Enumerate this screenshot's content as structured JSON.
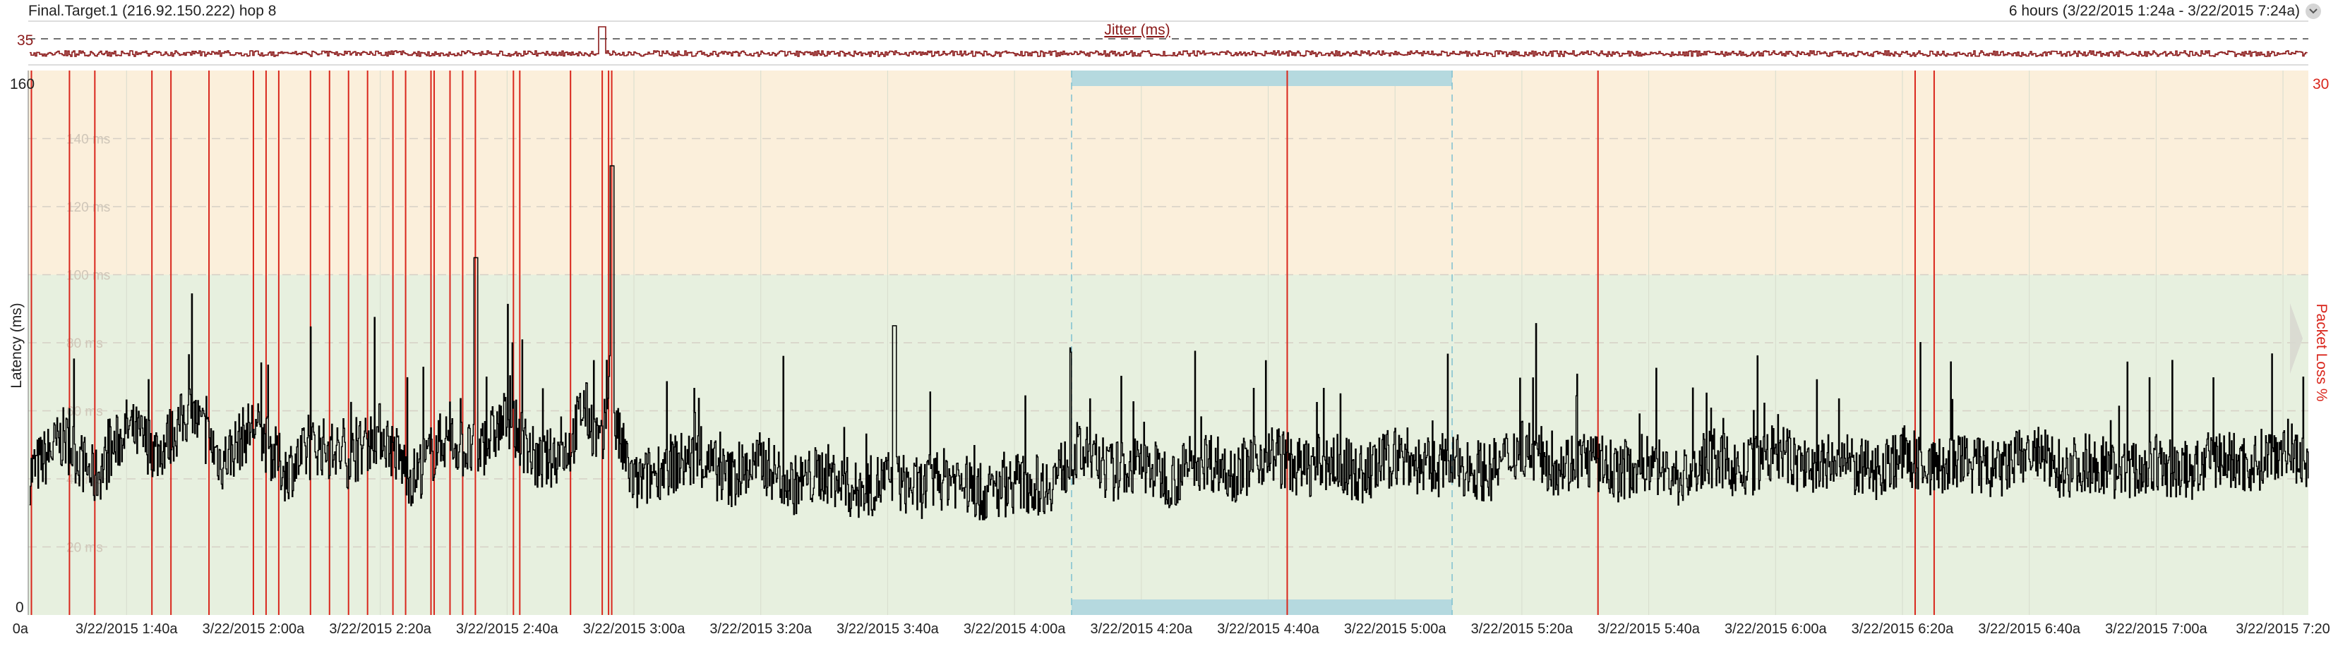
{
  "header": {
    "target": "Final.Target.1 (216.92.150.222) hop 8",
    "time_range": "6 hours (3/22/2015 1:24a - 3/22/2015 7:24a)"
  },
  "jitter": {
    "title": "Jitter (ms)",
    "scale_label": "35",
    "color": "#8b1a1a"
  },
  "chart_data": {
    "type": "line",
    "ylabel": "Latency (ms)",
    "y2label": "Packet Loss %",
    "ylim": [
      0,
      160
    ],
    "y2lim": [
      0,
      30
    ],
    "y_tick_labels": {
      "bottom": "0",
      "top": "160"
    },
    "y2_tick_label": "30",
    "zone_labels": [
      "140 ms",
      "120 ms",
      "100 ms",
      "80 ms",
      "60 ms",
      "40 ms",
      "20 ms"
    ],
    "zones": [
      {
        "from": 100,
        "to": 160,
        "color": "#fbefdb"
      },
      {
        "from": 0,
        "to": 100,
        "color": "#e7f0df"
      }
    ],
    "x_ticks": [
      "0a",
      "3/22/2015 1:40a",
      "3/22/2015 2:00a",
      "3/22/2015 2:20a",
      "3/22/2015 2:40a",
      "3/22/2015 3:00a",
      "3/22/2015 3:20a",
      "3/22/2015 3:40a",
      "3/22/2015 4:00a",
      "3/22/2015 4:20a",
      "3/22/2015 4:40a",
      "3/22/2015 5:00a",
      "3/22/2015 5:20a",
      "3/22/2015 5:40a",
      "3/22/2015 6:00a",
      "3/22/2015 6:20a",
      "3/22/2015 6:40a",
      "3/22/2015 7:00a",
      "3/22/2015 7:20"
    ],
    "x_minutes_range": [
      84.5,
      444
    ],
    "x_tick_minutes": [
      90,
      100,
      120,
      140,
      160,
      180,
      200,
      220,
      240,
      260,
      280,
      300,
      320,
      340,
      360,
      380,
      400,
      420,
      440
    ],
    "selection_minutes": [
      249,
      309
    ],
    "packet_loss_minutes": [
      85,
      91,
      95,
      104,
      107,
      113,
      120,
      122,
      124,
      129,
      132,
      135,
      138,
      142,
      144,
      148,
      148.5,
      151,
      153,
      155,
      161,
      162,
      170,
      175,
      176,
      176.5,
      283,
      332,
      382,
      385
    ],
    "latency_minutes": [
      85,
      90,
      95,
      100,
      105,
      110,
      115,
      120,
      125,
      130,
      135,
      140,
      145,
      150,
      155,
      160,
      165,
      170,
      172,
      175,
      176,
      177,
      180,
      185,
      190,
      195,
      200,
      205,
      210,
      215,
      220,
      225,
      230,
      235,
      240,
      245,
      250,
      255,
      260,
      265,
      270,
      275,
      280,
      285,
      290,
      295,
      300,
      305,
      310,
      315,
      320,
      325,
      330,
      335,
      340,
      345,
      350,
      355,
      360,
      365,
      370,
      375,
      380,
      385,
      390,
      395,
      400,
      405,
      410,
      415,
      420,
      425,
      430,
      435,
      440,
      444
    ],
    "latency_ms": [
      42,
      52,
      40,
      55,
      48,
      60,
      45,
      56,
      42,
      50,
      46,
      54,
      40,
      52,
      47,
      58,
      44,
      50,
      62,
      48,
      70,
      55,
      38,
      44,
      46,
      40,
      45,
      38,
      42,
      36,
      40,
      37,
      41,
      35,
      39,
      38,
      48,
      42,
      44,
      40,
      46,
      42,
      48,
      43,
      45,
      41,
      47,
      43,
      44,
      42,
      50,
      44,
      46,
      42,
      45,
      40,
      46,
      42,
      48,
      43,
      45,
      42,
      47,
      43,
      45,
      42,
      48,
      43,
      45,
      42,
      44,
      42,
      46,
      44,
      50,
      45
    ],
    "series": [
      {
        "name": "Latency (ms)",
        "color": "#000000"
      },
      {
        "name": "Packet Loss %",
        "color": "#d9261c"
      }
    ]
  }
}
